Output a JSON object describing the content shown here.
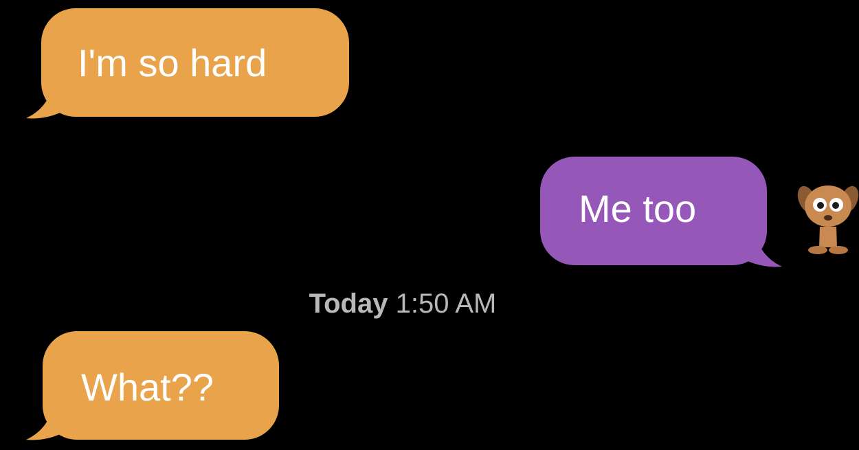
{
  "colors": {
    "background": "#000000",
    "incoming_bubble": "#e8a34b",
    "outgoing_bubble": "#9557b8",
    "timestamp_text": "#b8b8b8",
    "message_text": "#ffffff"
  },
  "messages": [
    {
      "direction": "incoming",
      "text": "I'm so hard"
    },
    {
      "direction": "outgoing",
      "text": "Me too"
    },
    {
      "direction": "incoming",
      "text": "What??"
    }
  ],
  "timestamp": {
    "day": "Today",
    "time": "1:50 AM"
  },
  "avatar": {
    "icon": "puppy-icon"
  }
}
